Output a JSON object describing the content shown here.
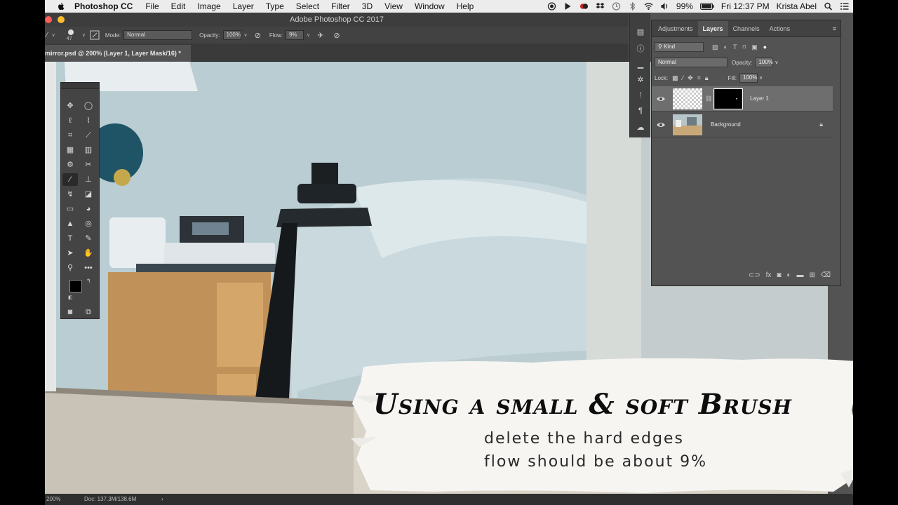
{
  "menubar": {
    "app_name": "Photoshop CC",
    "items": [
      "File",
      "Edit",
      "Image",
      "Layer",
      "Type",
      "Select",
      "Filter",
      "3D",
      "View",
      "Window",
      "Help"
    ],
    "battery": "99%",
    "clock": "Fri 12:37 PM",
    "user": "Krista Abel"
  },
  "window": {
    "title": "Adobe Photoshop CC 2017"
  },
  "options_bar": {
    "brush_size": "47",
    "mode_label": "Mode:",
    "mode_value": "Normal",
    "opacity_label": "Opacity:",
    "opacity_value": "100%",
    "flow_label": "Flow:",
    "flow_value": "9%"
  },
  "document": {
    "tab_title": "mirror.psd @ 200% (Layer 1, Layer Mask/16) *"
  },
  "layers_panel": {
    "tabs": [
      {
        "label": "Adjustments",
        "active": false
      },
      {
        "label": "Layers",
        "active": true
      },
      {
        "label": "Channels",
        "active": false
      },
      {
        "label": "Actions",
        "active": false
      }
    ],
    "filter_kind": "Kind",
    "blend_mode": "Normal",
    "opacity_label": "Opacity:",
    "opacity_value": "100%",
    "lock_label": "Lock:",
    "fill_label": "Fill:",
    "fill_value": "100%",
    "layers": [
      {
        "name": "Layer 1",
        "selected": true
      },
      {
        "name": "Background",
        "selected": false
      }
    ]
  },
  "status_bar": {
    "zoom": "200%",
    "doc_size": "Doc: 137.3M/138.6M"
  },
  "caption": {
    "headline": "Using a small & soft Brush",
    "line1": "delete the hard edges",
    "line2": "flow should be about 9%"
  },
  "colors": {
    "ui_dark": "#535353",
    "foreground": "#000000",
    "background": "#ffffff"
  }
}
